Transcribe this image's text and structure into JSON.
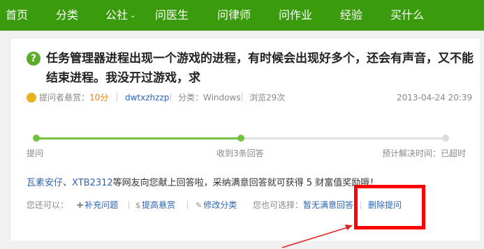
{
  "nav": {
    "items": [
      "首页",
      "分类",
      "公社",
      "问医生",
      "问律师",
      "问作业",
      "经验",
      "买什么"
    ],
    "caret": "⌄"
  },
  "question": {
    "icon": "?",
    "title": "任务管理器进程出现一个游戏的进程，有时候会出现好多个，还会有声音，又不能结束进程。我没开过游戏，求"
  },
  "meta": {
    "reward_label": "提问者悬赏：",
    "reward_value": "10分",
    "author": "dwtxzhzzp",
    "category": "分类：Windows",
    "views": "浏览29次",
    "date": "2013-04-24 20:39"
  },
  "progress": {
    "completed_fraction": 0.5,
    "labels": {
      "ask": "提问",
      "answers": "收到3条回答",
      "expected": "预计解决时间：已超时"
    }
  },
  "answer_notice": {
    "user1": "瓦素安仔",
    "sep": "、",
    "user2": "XTB2312",
    "text": "等网友向您献上回答啦，采纳满意回答就可获得 5 财富值奖励哦！"
  },
  "actions": {
    "you_can": "您还可以：",
    "supplement": "补充问题",
    "raise_reward": "提高悬赏",
    "change_category": "修改分类",
    "also_choose": "您也可选择：",
    "no_satisfactory": "暂无满意回答",
    "delete": "删除提问"
  },
  "colors": {
    "nav_bg": "#3a9b0c",
    "progress_fill": "#74c13f",
    "link": "#2d64b3",
    "reward": "#f08200",
    "highlight_box": "#ff0000",
    "arrow": "#e02020"
  },
  "icons": [
    "question-icon",
    "coin-icon",
    "plus-icon",
    "money-icon",
    "edit-icon",
    "arrow-annotation"
  ]
}
